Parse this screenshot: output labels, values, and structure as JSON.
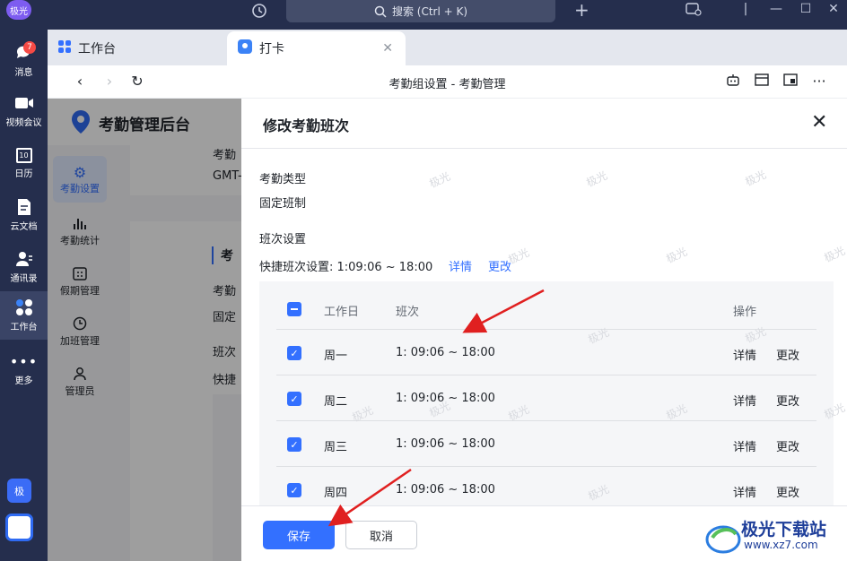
{
  "titlebar": {
    "avatar": "极光",
    "search_placeholder": "搜索 (Ctrl + K)"
  },
  "sidebar": {
    "items": [
      {
        "label": "消息",
        "badge": "7"
      },
      {
        "label": "视频会议"
      },
      {
        "label": "日历",
        "icon_text": "10"
      },
      {
        "label": "云文档"
      },
      {
        "label": "通讯录"
      },
      {
        "label": "工作台"
      },
      {
        "label": "更多"
      }
    ],
    "bottom_badge": "极"
  },
  "tabs": [
    {
      "label": "工作台"
    },
    {
      "label": "打卡"
    }
  ],
  "navbar": {
    "title": "考勤组设置 - 考勤管理"
  },
  "background": {
    "app_title": "考勤管理后台",
    "menu": [
      {
        "label": "考勤设置"
      },
      {
        "label": "考勤统计"
      },
      {
        "label": "假期管理"
      },
      {
        "label": "加班管理"
      },
      {
        "label": "管理员"
      }
    ],
    "fragments": [
      "考勤",
      "GMT-",
      "考",
      "考勤",
      "固定",
      "班次",
      "快捷"
    ]
  },
  "drawer": {
    "title": "修改考勤班次",
    "type_label": "考勤类型",
    "type_value": "固定班制",
    "shift_section_label": "班次设置",
    "quick_shift": "快捷班次设置: 1:09:06 ~ 18:00",
    "quick_details": "详情",
    "quick_change": "更改",
    "table": {
      "headers": [
        "工作日",
        "班次",
        "操作"
      ],
      "rows": [
        {
          "day": "周一",
          "shift": "1: 09:06 ~ 18:00",
          "details": "详情",
          "change": "更改"
        },
        {
          "day": "周二",
          "shift": "1: 09:06 ~ 18:00",
          "details": "详情",
          "change": "更改"
        },
        {
          "day": "周三",
          "shift": "1: 09:06 ~ 18:00",
          "details": "详情",
          "change": "更改"
        },
        {
          "day": "周四",
          "shift": "1: 09:06 ~ 18:00",
          "details": "详情",
          "change": "更改"
        }
      ]
    },
    "save": "保存",
    "cancel": "取消",
    "watermark": "极光"
  },
  "brand": {
    "name": "极光下载站",
    "url": "www.xz7.com"
  },
  "colors": {
    "accent": "#3370ff",
    "sidebar_bg": "#252e4d",
    "arrow": "#e02020"
  }
}
